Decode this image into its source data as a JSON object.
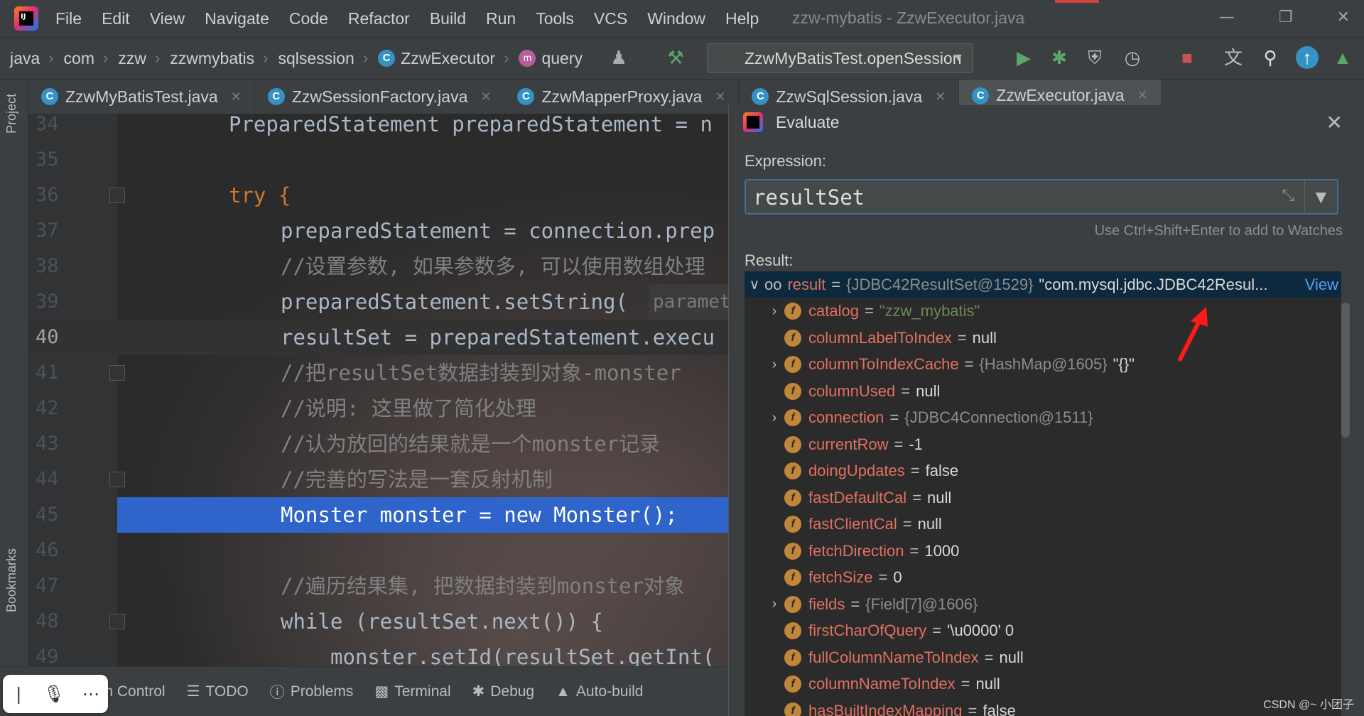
{
  "menubar": {
    "items": [
      "File",
      "Edit",
      "View",
      "Navigate",
      "Code",
      "Refactor",
      "Build",
      "Run",
      "Tools",
      "VCS",
      "Window",
      "Help"
    ],
    "title": "zzw-mybatis - ZzwExecutor.java"
  },
  "navbar": {
    "breadcrumbs": [
      "java",
      "com",
      "zzw",
      "zzwmybatis",
      "sqlsession",
      "ZzwExecutor",
      "query"
    ],
    "run_config": "ZzwMyBatisTest.openSession"
  },
  "left_stripe": {
    "project": "Project",
    "bookmarks": "Bookmarks"
  },
  "tabs": [
    {
      "label": "ZzwMyBatisTest.java",
      "active": false
    },
    {
      "label": "ZzwSessionFactory.java",
      "active": false
    },
    {
      "label": "ZzwMapperProxy.java",
      "active": false
    },
    {
      "label": "ZzwSqlSession.java",
      "active": false
    },
    {
      "label": "ZzwExecutor.java",
      "active": true
    }
  ],
  "editor": {
    "lines": [
      {
        "n": "34",
        "code": "PreparedStatement preparedStatement = n"
      },
      {
        "n": "35",
        "code": ""
      },
      {
        "n": "36",
        "code": "try {"
      },
      {
        "n": "37",
        "code": "preparedStatement = connection.prep"
      },
      {
        "n": "38",
        "code": "//设置参数, 如果参数多, 可以使用数组处理"
      },
      {
        "n": "39",
        "code": "preparedStatement.setString(",
        "hint": "paramet"
      },
      {
        "n": "40",
        "code": "resultSet = preparedStatement.execu"
      },
      {
        "n": "41",
        "code": "//把resultSet数据封装到对象-monster"
      },
      {
        "n": "42",
        "code": "//说明: 这里做了简化处理"
      },
      {
        "n": "43",
        "code": "//认为放回的结果就是一个monster记录"
      },
      {
        "n": "44",
        "code": "//完善的写法是一套反射机制"
      },
      {
        "n": "45",
        "code": "Monster monster = new Monster();"
      },
      {
        "n": "46",
        "code": ""
      },
      {
        "n": "47",
        "code": "//遍历结果集, 把数据封装到monster对象"
      },
      {
        "n": "48",
        "code": "while (resultSet.next()) {"
      },
      {
        "n": "49",
        "code": "monster.setId(resultSet.getInt("
      }
    ]
  },
  "bottombar": {
    "tabs": [
      "Version Control",
      "TODO",
      "Problems",
      "Terminal",
      "Debug",
      "Auto-build"
    ]
  },
  "evaluate": {
    "title": "Evaluate",
    "expression_label": "Expression:",
    "expression": "resultSet",
    "hint": "Use Ctrl+Shift+Enter to add to Watches",
    "result_label": "Result:",
    "root": {
      "name": "result",
      "type": "{JDBC42ResultSet@1529}",
      "value": "\"com.mysql.jdbc.JDBC42Resul...",
      "link": "View"
    },
    "fields": [
      {
        "name": "catalog",
        "value": "\"zzw_mybatis\"",
        "kind": "string",
        "expandable": true
      },
      {
        "name": "columnLabelToIndex",
        "value": "null",
        "kind": "plain",
        "expandable": false
      },
      {
        "name": "columnToIndexCache",
        "value": "{HashMap@1605}",
        "extra": "\"{}\"",
        "kind": "type",
        "expandable": true
      },
      {
        "name": "columnUsed",
        "value": "null",
        "kind": "plain",
        "expandable": false
      },
      {
        "name": "connection",
        "value": "{JDBC4Connection@1511}",
        "kind": "type",
        "expandable": true
      },
      {
        "name": "currentRow",
        "value": "-1",
        "kind": "plain",
        "expandable": false
      },
      {
        "name": "doingUpdates",
        "value": "false",
        "kind": "plain",
        "expandable": false
      },
      {
        "name": "fastDefaultCal",
        "value": "null",
        "kind": "plain",
        "expandable": false
      },
      {
        "name": "fastClientCal",
        "value": "null",
        "kind": "plain",
        "expandable": false
      },
      {
        "name": "fetchDirection",
        "value": "1000",
        "kind": "plain",
        "expandable": false
      },
      {
        "name": "fetchSize",
        "value": "0",
        "kind": "plain",
        "expandable": false
      },
      {
        "name": "fields",
        "value": "{Field[7]@1606}",
        "kind": "type",
        "expandable": true
      },
      {
        "name": "firstCharOfQuery",
        "value": "'\\u0000' 0",
        "kind": "plain",
        "expandable": false
      },
      {
        "name": "fullColumnNameToIndex",
        "value": "null",
        "kind": "plain",
        "expandable": false
      },
      {
        "name": "columnNameToIndex",
        "value": "null",
        "kind": "plain",
        "expandable": false
      },
      {
        "name": "hasBuiltIndexMapping",
        "value": "false",
        "kind": "plain",
        "expandable": false
      }
    ]
  },
  "watermark": "CSDN @~ 小团子",
  "colors": {
    "accent": "#4a88c7",
    "exec_line": "#2f65ca",
    "field_name": "#e07060",
    "string": "#6a8759"
  }
}
